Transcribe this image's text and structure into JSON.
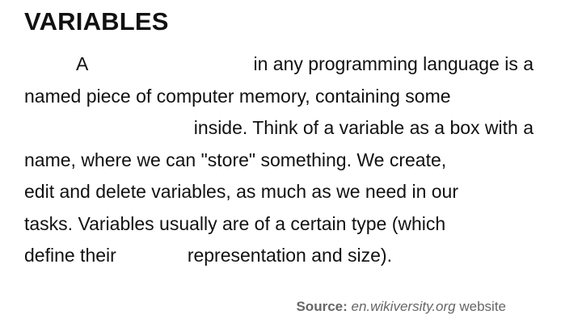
{
  "document": {
    "title": "VARIABLES",
    "paragraph_lines": [
      {
        "before": "A",
        "after": "in any programming language is a"
      },
      {
        "text": "named piece of computer memory, containing some"
      },
      {
        "before": "",
        "after": "inside. Think of a variable as a box with a"
      },
      {
        "text": "name, where we can \"store\" something. We create,"
      },
      {
        "text": "edit and delete variables, as much as we need in our"
      },
      {
        "text": "tasks. Variables usually are of a certain type (which"
      },
      {
        "before": "define their",
        "after": "representation and size)."
      }
    ],
    "source": {
      "label": "Source:",
      "site": "en.wikiversity.org",
      "suffix": "website"
    }
  }
}
